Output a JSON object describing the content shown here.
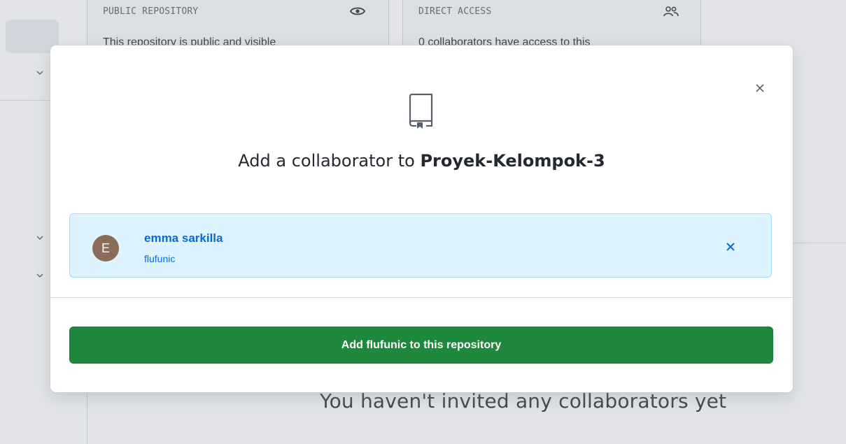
{
  "background": {
    "cards": [
      {
        "title": "PUBLIC REPOSITORY",
        "icon": "eye-icon",
        "description": "This repository is public and visible"
      },
      {
        "title": "DIRECT ACCESS",
        "icon": "people-icon",
        "description": "0 collaborators have access to this"
      }
    ],
    "empty_state_heading": "You haven't invited any collaborators yet"
  },
  "modal": {
    "icon": "repo-icon",
    "title_prefix": "Add a collaborator to ",
    "repo_name": "Proyek-Kelompok-3",
    "close_icon": "close-icon",
    "selected_user": {
      "avatar_letter": "E",
      "name": "emma sarkilla",
      "login": "flufunic",
      "remove_icon": "close-icon"
    },
    "add_button_label": "Add flufunic to this repository"
  },
  "colors": {
    "primary_button": "#1f883d",
    "link": "#0969da",
    "selected_bg": "#ddf4ff",
    "avatar": "#8b6b5a"
  }
}
